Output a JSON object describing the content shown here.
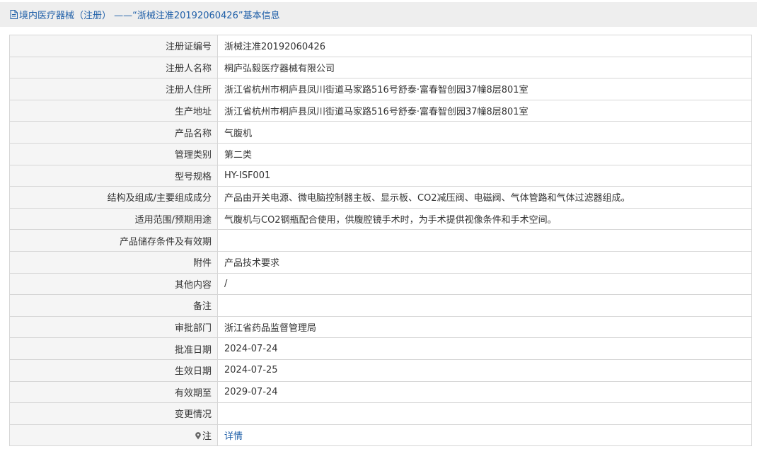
{
  "header": {
    "title": "境内医疗器械（注册） ——“浙械注准20192060426”基本信息",
    "icon": "document-icon"
  },
  "colors": {
    "accent": "#1f5fa8",
    "label_bg": "#f5f5f5",
    "border": "#d6d6d6",
    "header_bg": "#eeeeee"
  },
  "rows": [
    {
      "label": "注册证编号",
      "value": "浙械注准20192060426"
    },
    {
      "label": "注册人名称",
      "value": "桐庐弘毅医疗器械有限公司"
    },
    {
      "label": "注册人住所",
      "value": "浙江省杭州市桐庐县凤川街道马家路516号舒泰·富春智创园37幢8层801室"
    },
    {
      "label": "生产地址",
      "value": "浙江省杭州市桐庐县凤川街道马家路516号舒泰·富春智创园37幢8层801室"
    },
    {
      "label": "产品名称",
      "value": "气腹机"
    },
    {
      "label": "管理类别",
      "value": "第二类"
    },
    {
      "label": "型号规格",
      "value": "HY-ISF001"
    },
    {
      "label": "结构及组成/主要组成成分",
      "value": "产品由开关电源、微电脑控制器主板、显示板、CO2减压阀、电磁阀、气体管路和气体过滤器组成。"
    },
    {
      "label": "适用范围/预期用途",
      "value": "气腹机与CO2钢瓶配合使用，供腹腔镜手术时，为手术提供视像条件和手术空间。"
    },
    {
      "label": "产品储存条件及有效期",
      "value": ""
    },
    {
      "label": "附件",
      "value": "产品技术要求"
    },
    {
      "label": "其他内容",
      "value": "/"
    },
    {
      "label": "备注",
      "value": ""
    },
    {
      "label": "审批部门",
      "value": "浙江省药品监督管理局"
    },
    {
      "label": "批准日期",
      "value": "2024-07-24"
    },
    {
      "label": "生效日期",
      "value": "2024-07-25"
    },
    {
      "label": "有效期至",
      "value": "2029-07-24"
    },
    {
      "label": "变更情况",
      "value": ""
    }
  ],
  "note_row": {
    "label": "注",
    "icon": "pin-icon",
    "link_text": "详情"
  }
}
